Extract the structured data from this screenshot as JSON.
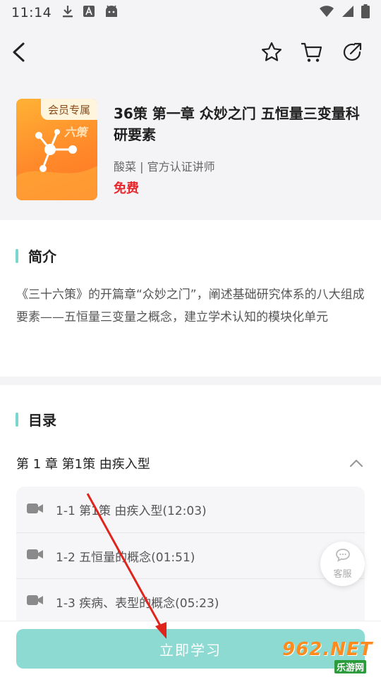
{
  "status_bar": {
    "time": "11:14",
    "icons": [
      "download-icon",
      "a-box-icon",
      "android-icon",
      "wifi-icon",
      "signal-icon",
      "battery-icon"
    ]
  },
  "top_bar": {
    "icons": [
      "back-icon",
      "star-icon",
      "cart-icon",
      "share-icon"
    ]
  },
  "course": {
    "cover_badge": "会员专属",
    "cover_text": "六策",
    "title": "36策 第一章 众妙之门 五恒量三变量科研要素",
    "author": "酸菜 | 官方认证讲师",
    "price": "免费",
    "price_color": "#e9262c"
  },
  "intro": {
    "heading": "简介",
    "text": "《三十六策》的开篇章“众妙之门”，阐述基础研究体系的八大组成要素——五恒量三变量之概念，建立学术认知的模块化单元"
  },
  "toc": {
    "heading": "目录",
    "chapter": "第 1 章 第1策 由疾入型",
    "lessons": [
      "1-1 第1策 由疾入型(12:03)",
      "1-2 五恒量的概念(01:51)",
      "1-3 疾病、表型的概念(05:23)"
    ]
  },
  "service": {
    "label": "客服",
    "icon": "chat-bubble-icon"
  },
  "bottom": {
    "study_button_label": "立即学习",
    "accent_color": "#8ddad3"
  },
  "watermark": {
    "main": "962.NET",
    "sub": "乐游网"
  },
  "colors": {
    "section_bar": "#7ad7d0",
    "annotation_arrow": "#e0241b"
  }
}
